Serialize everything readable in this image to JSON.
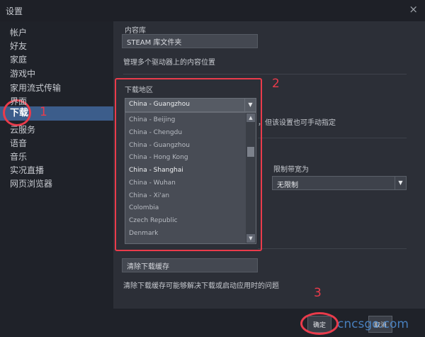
{
  "window": {
    "title": "设置",
    "close_glyph": "×"
  },
  "sidebar": {
    "items": [
      {
        "label": "帐户"
      },
      {
        "label": "好友"
      },
      {
        "label": "家庭"
      },
      {
        "label": "游戏中"
      },
      {
        "label": "家用流式传输"
      },
      {
        "label": "界面"
      },
      {
        "label": "下载",
        "selected": true
      },
      {
        "label": "云服务"
      },
      {
        "label": "语音"
      },
      {
        "label": "音乐"
      },
      {
        "label": "实况直播"
      },
      {
        "label": "网页浏览器"
      }
    ]
  },
  "content": {
    "library_heading": "内容库",
    "library_button": "STEAM 库文件夹",
    "library_desc": "管理多个驱动器上的内容位置",
    "region_label": "下载地区",
    "region_selected": "China - Guangzhou",
    "region_options": [
      "China - Beijing",
      "China - Chengdu",
      "China - Guangzhou",
      "China - Hong Kong",
      "China - Shanghai",
      "China - Wuhan",
      "China - Xi'an",
      "Colombia",
      "Czech Republic",
      "Denmark"
    ],
    "region_highlighted": "China - Shanghai",
    "region_hint": "，但该设置也可手动指定",
    "bandwidth_label": "限制带宽为",
    "bandwidth_value": "无限制",
    "clear_cache_button": "清除下载缓存",
    "clear_cache_desc": "清除下载缓存可能够解决下载或启动应用时的问题"
  },
  "footer": {
    "ok_label": "确定",
    "cancel_label": "取消",
    "watermark": "cncsgo.com"
  },
  "annotations": {
    "step1": "1",
    "step2": "2",
    "step3": "3"
  },
  "icons": {
    "dropdown_arrow": "▼",
    "scroll_up": "▲",
    "scroll_down": "▼"
  },
  "colors": {
    "selected_bg": "#3c5d8b",
    "annotation": "#ea3b4b",
    "watermark": "#4f8fd6"
  }
}
